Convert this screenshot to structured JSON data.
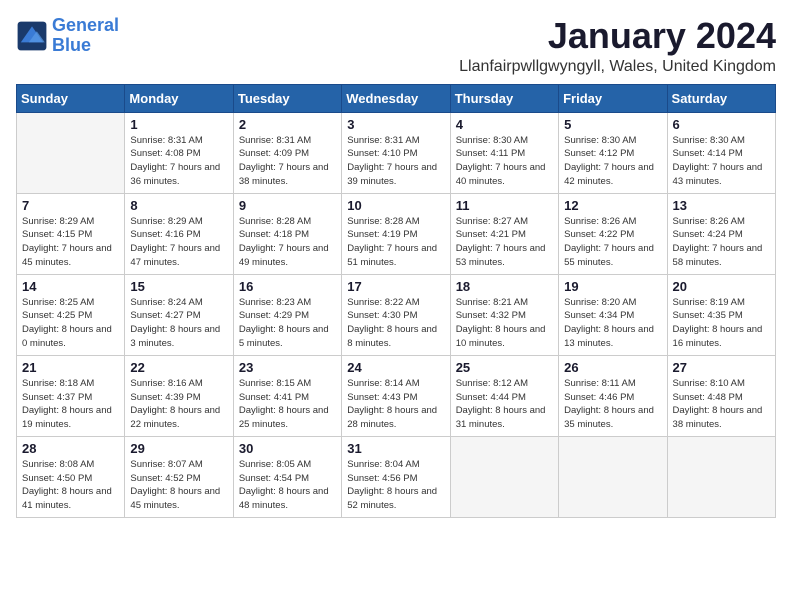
{
  "logo": {
    "text_general": "General",
    "text_blue": "Blue"
  },
  "title": "January 2024",
  "subtitle": "Llanfairpwllgwyngyll, Wales, United Kingdom",
  "weekdays": [
    "Sunday",
    "Monday",
    "Tuesday",
    "Wednesday",
    "Thursday",
    "Friday",
    "Saturday"
  ],
  "weeks": [
    [
      {
        "day": "",
        "sunrise": "",
        "sunset": "",
        "daylight": ""
      },
      {
        "day": "1",
        "sunrise": "8:31 AM",
        "sunset": "4:08 PM",
        "daylight": "7 hours and 36 minutes."
      },
      {
        "day": "2",
        "sunrise": "8:31 AM",
        "sunset": "4:09 PM",
        "daylight": "7 hours and 38 minutes."
      },
      {
        "day": "3",
        "sunrise": "8:31 AM",
        "sunset": "4:10 PM",
        "daylight": "7 hours and 39 minutes."
      },
      {
        "day": "4",
        "sunrise": "8:30 AM",
        "sunset": "4:11 PM",
        "daylight": "7 hours and 40 minutes."
      },
      {
        "day": "5",
        "sunrise": "8:30 AM",
        "sunset": "4:12 PM",
        "daylight": "7 hours and 42 minutes."
      },
      {
        "day": "6",
        "sunrise": "8:30 AM",
        "sunset": "4:14 PM",
        "daylight": "7 hours and 43 minutes."
      }
    ],
    [
      {
        "day": "7",
        "sunrise": "8:29 AM",
        "sunset": "4:15 PM",
        "daylight": "7 hours and 45 minutes."
      },
      {
        "day": "8",
        "sunrise": "8:29 AM",
        "sunset": "4:16 PM",
        "daylight": "7 hours and 47 minutes."
      },
      {
        "day": "9",
        "sunrise": "8:28 AM",
        "sunset": "4:18 PM",
        "daylight": "7 hours and 49 minutes."
      },
      {
        "day": "10",
        "sunrise": "8:28 AM",
        "sunset": "4:19 PM",
        "daylight": "7 hours and 51 minutes."
      },
      {
        "day": "11",
        "sunrise": "8:27 AM",
        "sunset": "4:21 PM",
        "daylight": "7 hours and 53 minutes."
      },
      {
        "day": "12",
        "sunrise": "8:26 AM",
        "sunset": "4:22 PM",
        "daylight": "7 hours and 55 minutes."
      },
      {
        "day": "13",
        "sunrise": "8:26 AM",
        "sunset": "4:24 PM",
        "daylight": "7 hours and 58 minutes."
      }
    ],
    [
      {
        "day": "14",
        "sunrise": "8:25 AM",
        "sunset": "4:25 PM",
        "daylight": "8 hours and 0 minutes."
      },
      {
        "day": "15",
        "sunrise": "8:24 AM",
        "sunset": "4:27 PM",
        "daylight": "8 hours and 3 minutes."
      },
      {
        "day": "16",
        "sunrise": "8:23 AM",
        "sunset": "4:29 PM",
        "daylight": "8 hours and 5 minutes."
      },
      {
        "day": "17",
        "sunrise": "8:22 AM",
        "sunset": "4:30 PM",
        "daylight": "8 hours and 8 minutes."
      },
      {
        "day": "18",
        "sunrise": "8:21 AM",
        "sunset": "4:32 PM",
        "daylight": "8 hours and 10 minutes."
      },
      {
        "day": "19",
        "sunrise": "8:20 AM",
        "sunset": "4:34 PM",
        "daylight": "8 hours and 13 minutes."
      },
      {
        "day": "20",
        "sunrise": "8:19 AM",
        "sunset": "4:35 PM",
        "daylight": "8 hours and 16 minutes."
      }
    ],
    [
      {
        "day": "21",
        "sunrise": "8:18 AM",
        "sunset": "4:37 PM",
        "daylight": "8 hours and 19 minutes."
      },
      {
        "day": "22",
        "sunrise": "8:16 AM",
        "sunset": "4:39 PM",
        "daylight": "8 hours and 22 minutes."
      },
      {
        "day": "23",
        "sunrise": "8:15 AM",
        "sunset": "4:41 PM",
        "daylight": "8 hours and 25 minutes."
      },
      {
        "day": "24",
        "sunrise": "8:14 AM",
        "sunset": "4:43 PM",
        "daylight": "8 hours and 28 minutes."
      },
      {
        "day": "25",
        "sunrise": "8:12 AM",
        "sunset": "4:44 PM",
        "daylight": "8 hours and 31 minutes."
      },
      {
        "day": "26",
        "sunrise": "8:11 AM",
        "sunset": "4:46 PM",
        "daylight": "8 hours and 35 minutes."
      },
      {
        "day": "27",
        "sunrise": "8:10 AM",
        "sunset": "4:48 PM",
        "daylight": "8 hours and 38 minutes."
      }
    ],
    [
      {
        "day": "28",
        "sunrise": "8:08 AM",
        "sunset": "4:50 PM",
        "daylight": "8 hours and 41 minutes."
      },
      {
        "day": "29",
        "sunrise": "8:07 AM",
        "sunset": "4:52 PM",
        "daylight": "8 hours and 45 minutes."
      },
      {
        "day": "30",
        "sunrise": "8:05 AM",
        "sunset": "4:54 PM",
        "daylight": "8 hours and 48 minutes."
      },
      {
        "day": "31",
        "sunrise": "8:04 AM",
        "sunset": "4:56 PM",
        "daylight": "8 hours and 52 minutes."
      },
      {
        "day": "",
        "sunrise": "",
        "sunset": "",
        "daylight": ""
      },
      {
        "day": "",
        "sunrise": "",
        "sunset": "",
        "daylight": ""
      },
      {
        "day": "",
        "sunrise": "",
        "sunset": "",
        "daylight": ""
      }
    ]
  ]
}
